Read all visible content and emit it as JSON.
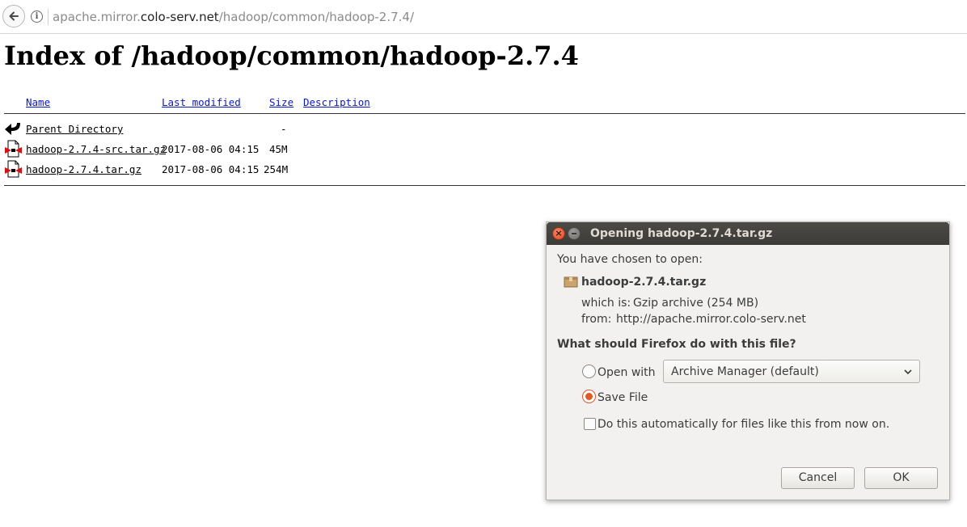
{
  "browser": {
    "url_prefix": "apache.mirror.",
    "url_host": "colo-serv.net",
    "url_path": "/hadoop/common/hadoop-2.7.4/"
  },
  "index": {
    "title": "Index of /hadoop/common/hadoop-2.7.4",
    "columns": {
      "name": "Name",
      "last_modified": "Last modified",
      "size": "Size",
      "description": "Description"
    },
    "rows": [
      {
        "icon": "back-arrow-icon",
        "name": "Parent Directory",
        "modified": "",
        "size": "-"
      },
      {
        "icon": "compressed-file-icon",
        "name": "hadoop-2.7.4-src.tar.gz",
        "modified": "2017-08-06 04:15",
        "size": "45M"
      },
      {
        "icon": "compressed-file-icon",
        "name": "hadoop-2.7.4.tar.gz",
        "modified": "2017-08-06 04:15",
        "size": "254M"
      }
    ]
  },
  "dialog": {
    "title": "Opening hadoop-2.7.4.tar.gz",
    "chosen_label": "You have chosen to open:",
    "file_name": "hadoop-2.7.4.tar.gz",
    "which_is_label": "which is:",
    "which_is_value": "Gzip archive (254 MB)",
    "from_label": "from:",
    "from_value": "http://apache.mirror.colo-serv.net",
    "question": "What should Firefox do with this file?",
    "open_with_label": "Open with",
    "open_with_app": "Archive Manager (default)",
    "save_file_label": "Save File",
    "auto_label": "Do this automatically for files like this from now on.",
    "selected_action": "save",
    "auto_checked": false,
    "cancel_label": "Cancel",
    "ok_label": "OK",
    "accent_color": "#e05a28"
  }
}
